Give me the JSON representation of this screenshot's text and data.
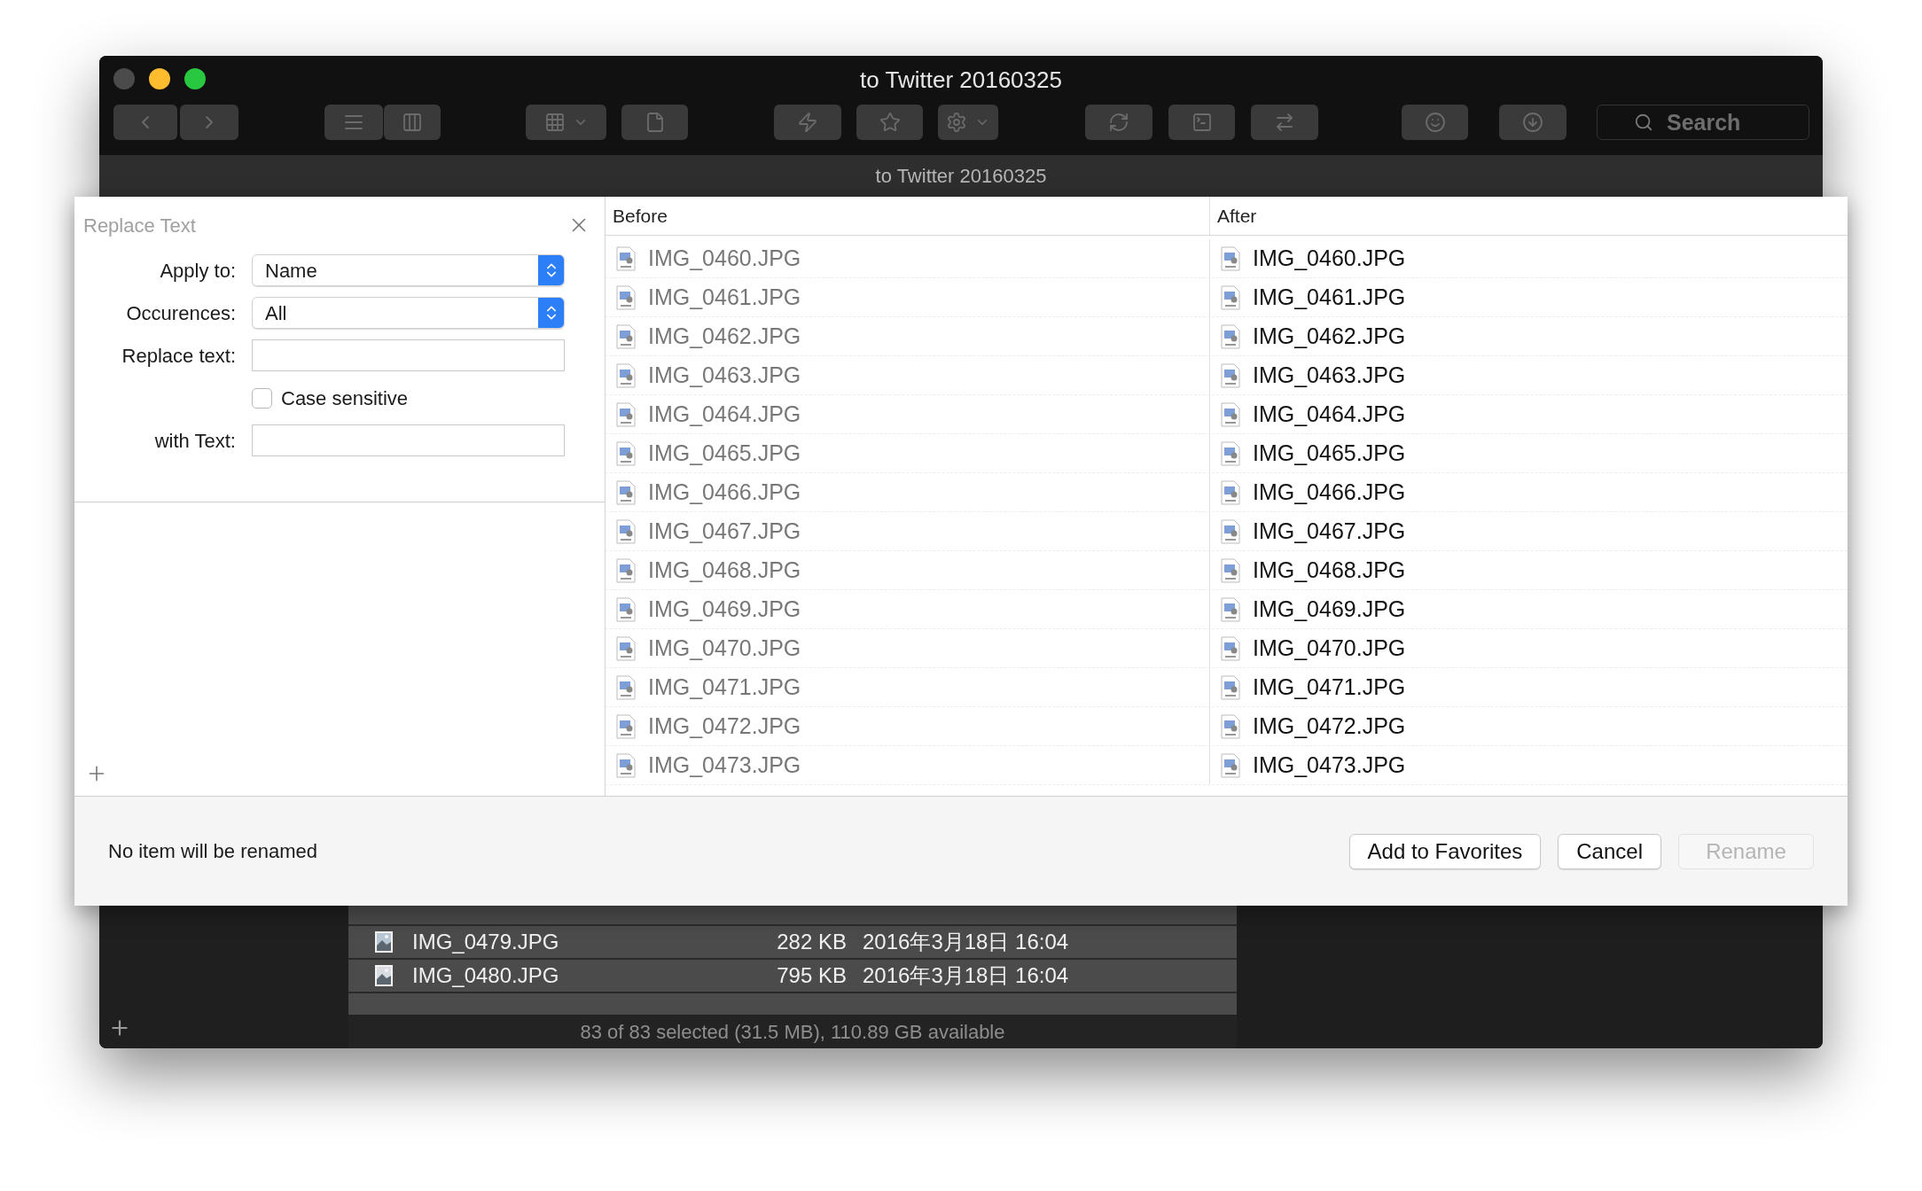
{
  "window": {
    "title": "to Twitter 20160325",
    "path_title": "to Twitter 20160325"
  },
  "toolbar": {
    "search": {
      "placeholder": "Search"
    }
  },
  "sheet": {
    "title": "Replace Text",
    "fields": [
      {
        "kind": "popup",
        "label": "Apply to:",
        "value": "Name"
      },
      {
        "kind": "popup",
        "label": "Occurences:",
        "value": "All"
      },
      {
        "kind": "text",
        "label": "Replace text:"
      },
      {
        "kind": "checkbox",
        "label": "Case sensitive",
        "checked": false
      },
      {
        "kind": "text",
        "label": "with Text:"
      }
    ],
    "table": {
      "columns": [
        "Before",
        "After"
      ],
      "rows": [
        {
          "before": "IMG_0460.JPG",
          "after": "IMG_0460.JPG"
        },
        {
          "before": "IMG_0461.JPG",
          "after": "IMG_0461.JPG"
        },
        {
          "before": "IMG_0462.JPG",
          "after": "IMG_0462.JPG"
        },
        {
          "before": "IMG_0463.JPG",
          "after": "IMG_0463.JPG"
        },
        {
          "before": "IMG_0464.JPG",
          "after": "IMG_0464.JPG"
        },
        {
          "before": "IMG_0465.JPG",
          "after": "IMG_0465.JPG"
        },
        {
          "before": "IMG_0466.JPG",
          "after": "IMG_0466.JPG"
        },
        {
          "before": "IMG_0467.JPG",
          "after": "IMG_0467.JPG"
        },
        {
          "before": "IMG_0468.JPG",
          "after": "IMG_0468.JPG"
        },
        {
          "before": "IMG_0469.JPG",
          "after": "IMG_0469.JPG"
        },
        {
          "before": "IMG_0470.JPG",
          "after": "IMG_0470.JPG"
        },
        {
          "before": "IMG_0471.JPG",
          "after": "IMG_0471.JPG"
        },
        {
          "before": "IMG_0472.JPG",
          "after": "IMG_0472.JPG"
        },
        {
          "before": "IMG_0473.JPG",
          "after": "IMG_0473.JPG"
        }
      ]
    },
    "status": "No item will be renamed",
    "buttons": [
      {
        "label": "Add to Favorites",
        "disabled": false
      },
      {
        "label": "Cancel",
        "disabled": false
      },
      {
        "label": "Rename",
        "disabled": true
      }
    ]
  },
  "file_list": {
    "rows": [
      {
        "name": "IMG_0479.JPG",
        "size": "282 KB",
        "date": "2016年3月18日 16:04"
      },
      {
        "name": "IMG_0480.JPG",
        "size": "795 KB",
        "date": "2016年3月18日 16:04"
      }
    ],
    "status_bar": "83 of 83 selected (31.5 MB), 110.89 GB available"
  }
}
